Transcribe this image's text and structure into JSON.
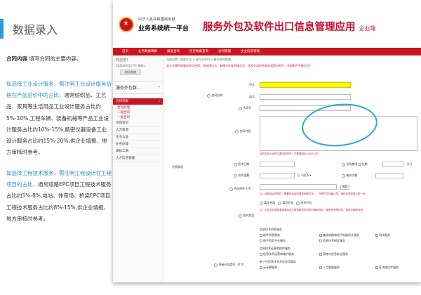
{
  "slide": {
    "title": "数据录入",
    "intro_bold": "合同内容",
    "intro_rest": "填写合同的主要内容。",
    "p1_hl": "如选择工业设计服务，需注明工业设计服务价格在产品总价中的占比，",
    "p1_rest": "通常纺织品、工艺品、家具等生活用品工业设计服务占比约5%-10%,工程车辆、装备机械等产品工业设计服务占比约10%-15%,精密仪器设备工业设计服务占比约15%-20%,供企业填报、地方审核时参考。",
    "p2_hl": "如选择工程技术服务，需注明工程设计在工程项目的占比，",
    "p2_rest": "通常道路EPC项目工程技术服务占比约5%-8%,电站、体育场、桥梁EPC项目工程技术服务占比约8%-15%,供企业填报、地方审核时参考。"
  },
  "app": {
    "ministry": "中华人民共和国商务部",
    "platform": "业务系统统一平台",
    "title": "服务外包及软件出口信息管理应用",
    "title_suffix": "企业端",
    "topnav": [
      "首页",
      "业务数据填报",
      "报送查询",
      "历史数据查询",
      "合同管理",
      "企业信息管理"
    ],
    "welcome": "欢迎您！",
    "date": "2021年6月17日 星期二",
    "exit": "退出系统",
    "menu_group": "服务外包数...",
    "menu_items": [
      "合同列表",
      "合同办理",
      "一般合同",
      "一般合同",
      "合同登记",
      "人力资源",
      "企业认证",
      "业务办理",
      "审核工期",
      "人才信息管理"
    ],
    "breadcrumb": "当前位置：服务外包 > 接包方序列 > 接包合同管理",
    "notice": "本企业提供的服务外包合同，如无接包方，有接包外发的接包方，涉及业务的合同必须提交附件，合同附件不能为空！",
    "labels": {
      "contract_name": "合同名称",
      "cn": "中文",
      "en": "英文",
      "contract_no": "合同号",
      "content": "合同内容",
      "contract_info": "合同情况",
      "sign_date": "签字日期",
      "contract_period": "合同期限",
      "long_term": "长期",
      "amount": "合同金额",
      "currency": "人民币",
      "service_count": "服务次数",
      "attachment": "合同附件上传",
      "add": "添加",
      "contract_type": "合同类型",
      "business_type": "承接业务类别（ITO）"
    },
    "content_hint": "合同内容为合同主要内容简写，字数限制为500字以内",
    "attach_hint": "注：请添加合同附件（需要包含合同首页和签字页），在附件中加盖公章，每份合同仅能上传一份",
    "type_options": [
      "离岸合同",
      "离岸外包",
      "在岸外包"
    ],
    "type_notes": "注：企业向外国或者港澳台企业提供服务的合同为离岸合同，使用外资签约的，原则为离岸合同。",
    "ito_group1": "信息技术研发服务",
    "ito_items1": [
      "软件研发服务",
      "电子商务平台服务",
      "集成电路和电子电路设计服务",
      "测试服务",
      "信息技术研发服务"
    ],
    "ito_group2": "信息技术运营和维护服务",
    "ito_items2": [
      "信息技术运营和维护服务",
      "网络与信息安全服务"
    ],
    "ito_group3": "新一代信息技术开发应用服务",
    "ito_items3": [
      "云计算服务",
      "人工智能服务",
      "区块链技术服务"
    ]
  }
}
